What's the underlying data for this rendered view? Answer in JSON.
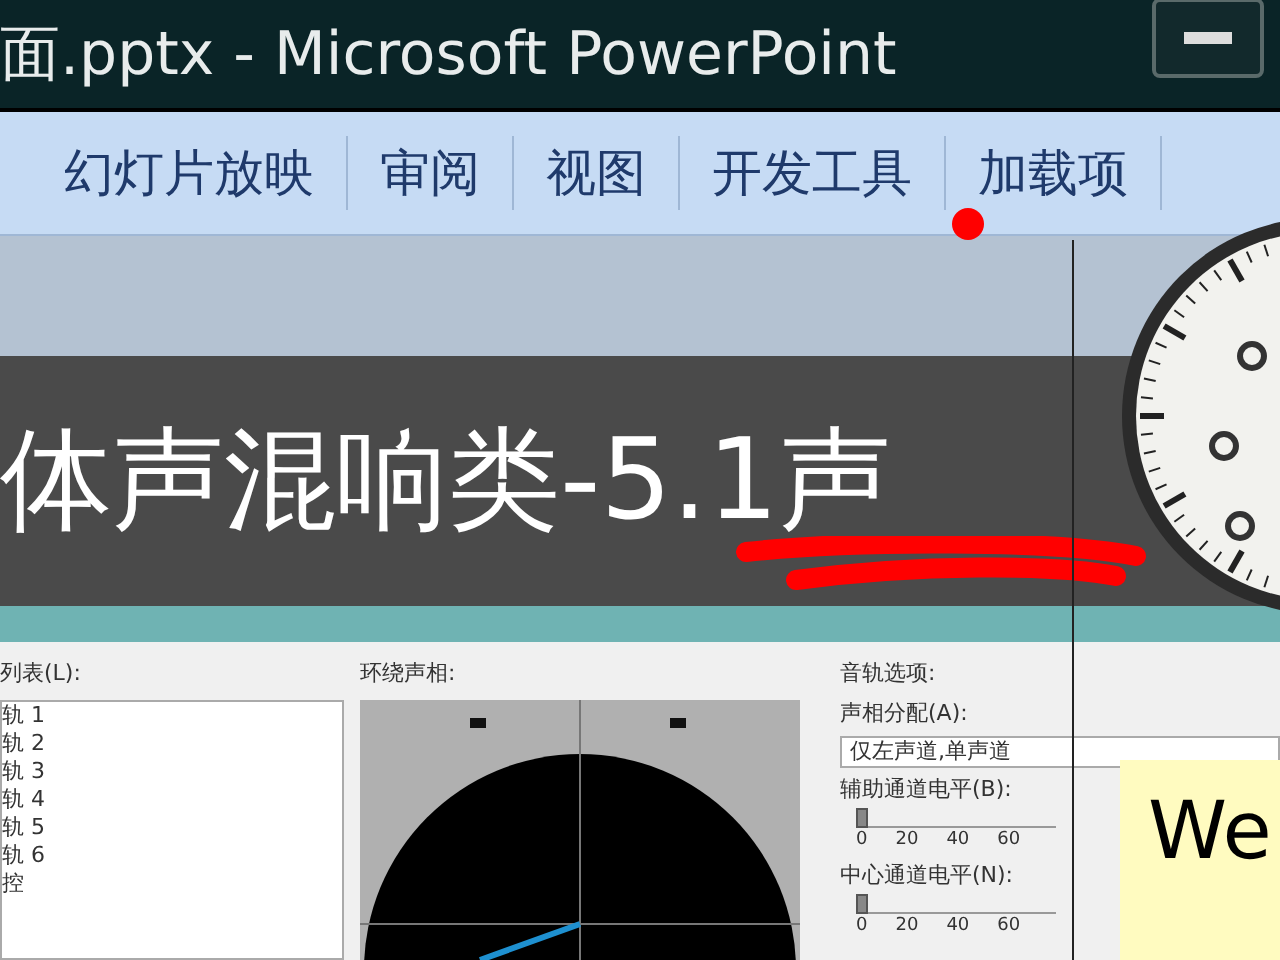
{
  "window": {
    "title": "面.pptx - Microsoft PowerPoint"
  },
  "ribbon_tabs": [
    {
      "label": "幻灯片放映",
      "selected": false
    },
    {
      "label": "审阅",
      "selected": false
    },
    {
      "label": "视图",
      "selected": false
    },
    {
      "label": "开发工具",
      "selected": false
    },
    {
      "label": "加载项",
      "selected": false
    }
  ],
  "slide": {
    "title": "体声混响类-5.1声"
  },
  "dialog": {
    "list_label": "列表(L):",
    "tracks": [
      {
        "label": "轨 1",
        "selected": false
      },
      {
        "label": "轨 2",
        "selected": false
      },
      {
        "label": "轨 3",
        "selected": false
      },
      {
        "label": "轨 4",
        "selected": false
      },
      {
        "label": "轨 5",
        "selected": false
      },
      {
        "label": "轨 6",
        "selected": false
      },
      {
        "label": "控",
        "selected": false
      }
    ],
    "surround_label": "环绕声相:",
    "options_label": "音轨选项:",
    "pan_label": "声相分配(A):",
    "pan_value": "仅左声道,单声道",
    "sliders": [
      {
        "label": "辅助通道电平(B):",
        "level": 0,
        "ticks": [
          "0",
          "20",
          "40",
          "60"
        ]
      },
      {
        "label": "中心通道电平(N):",
        "level": 0,
        "ticks": [
          "0",
          "20",
          "40",
          "60"
        ]
      }
    ]
  },
  "note": {
    "text": "We"
  }
}
